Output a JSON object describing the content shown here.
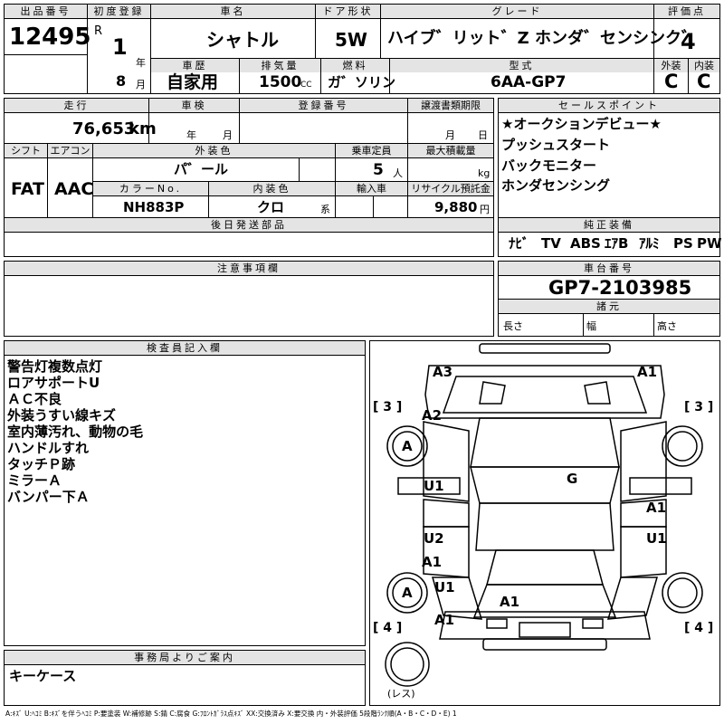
{
  "header": {
    "lot_no_label": "出品番号",
    "lot_no": "12495",
    "first_reg_label": "初度登録",
    "era": "R",
    "year": "1",
    "year_unit": "年",
    "month": "8",
    "month_unit": "月",
    "car_name_label": "車名",
    "car_name": "シャトル",
    "door_label": "ドア形状",
    "door": "5W",
    "grade_label": "グレード",
    "grade": "ハイブ゛リット゛Z ホンダ゛センシンク゛",
    "score_label": "評価点",
    "score": "4",
    "history_label": "車歴",
    "history": "自家用",
    "displacement_label": "排気量",
    "displacement": "1500",
    "displacement_unit": "CC",
    "fuel_label": "燃料",
    "fuel": "ガ゛ソリン",
    "model_label": "型式",
    "model": "6AA-GP7",
    "exterior_label": "外装",
    "exterior_grade": "C",
    "interior_label": "内装",
    "interior_grade": "C"
  },
  "row2": {
    "mileage_label": "走行",
    "mileage": "76,653",
    "mileage_unit": "km",
    "inspection_label": "車検",
    "inspection_year_unit": "年",
    "inspection_month_unit": "月",
    "reg_no_label": "登録番号",
    "transfer_label": "譲渡書類期限",
    "transfer_month_unit": "月",
    "transfer_day_unit": "日",
    "shift_label": "シフト",
    "shift": "FAT",
    "ac_label": "エアコン",
    "ac": "AAC",
    "color_label": "外装色",
    "color": "パ゛ール",
    "capacity_label": "乗車定員",
    "capacity": "5",
    "capacity_unit": "人",
    "load_label": "最大積載量",
    "load_unit": "kg",
    "color_no_label": "カラーNo.",
    "color_no": "NH883P",
    "int_color_label": "内装色",
    "int_color": "クロ",
    "int_color_unit": "系",
    "import_label": "輸入車",
    "recycle_label": "リサイクル預託金",
    "recycle": "9,880",
    "recycle_unit": "円"
  },
  "sales_points": {
    "label": "セールスポイント",
    "items": [
      "★オークションデビュー★",
      "プッシュスタート",
      "バックモニター",
      "ホンダセンシング"
    ]
  },
  "later_parts_label": "後日発送部品",
  "equipment": {
    "label": "純正装備",
    "items": [
      "ﾅﾋﾞ",
      "TV",
      "ABS",
      "ｴｱB",
      "ｱﾙﾐ",
      "PS",
      "PW"
    ]
  },
  "notes_label": "注意事項欄",
  "chassis": {
    "label": "車台番号",
    "value": "GP7-2103985"
  },
  "specs": {
    "label": "諸元",
    "length": "長さ",
    "width": "幅",
    "height": "高さ"
  },
  "inspector": {
    "label": "検査員記入欄",
    "lines": [
      "警告灯複数点灯",
      "ロアサポートU",
      "ＡＣ不良",
      "外装うすい線キズ",
      "室内薄汚れ、動物の毛",
      "ハンドルすれ",
      "タッチＰ跡",
      "ミラーＡ",
      "バンパー下Ａ"
    ]
  },
  "office": {
    "label": "事務局よりご案内",
    "text": "キーケース"
  },
  "legend": "A:ｷｽﾞ U:ﾍｺﾐ B:ｷｽﾞを伴うﾍｺﾐ P:要塗装 W:補修跡 S:錆 C:腐食 G:ﾌﾛﾝﾄｶﾞﾗｽ点ｷｽﾞ XX:交換済み X:要交換 内・外装評価 5段階ﾗﾝｸ順(A・B・C・D・E) 1",
  "diagram": {
    "marks": [
      "A3",
      "A1",
      "A2",
      "A",
      "G",
      "U1",
      "A1",
      "U2",
      "A1",
      "U1",
      "A",
      "U1",
      "A1",
      "A1"
    ],
    "tire_tread": [
      "[ 3 ]",
      "[ 3 ]",
      "[ 4 ]",
      "[ 4 ]"
    ],
    "spare_label": "(レス)"
  }
}
